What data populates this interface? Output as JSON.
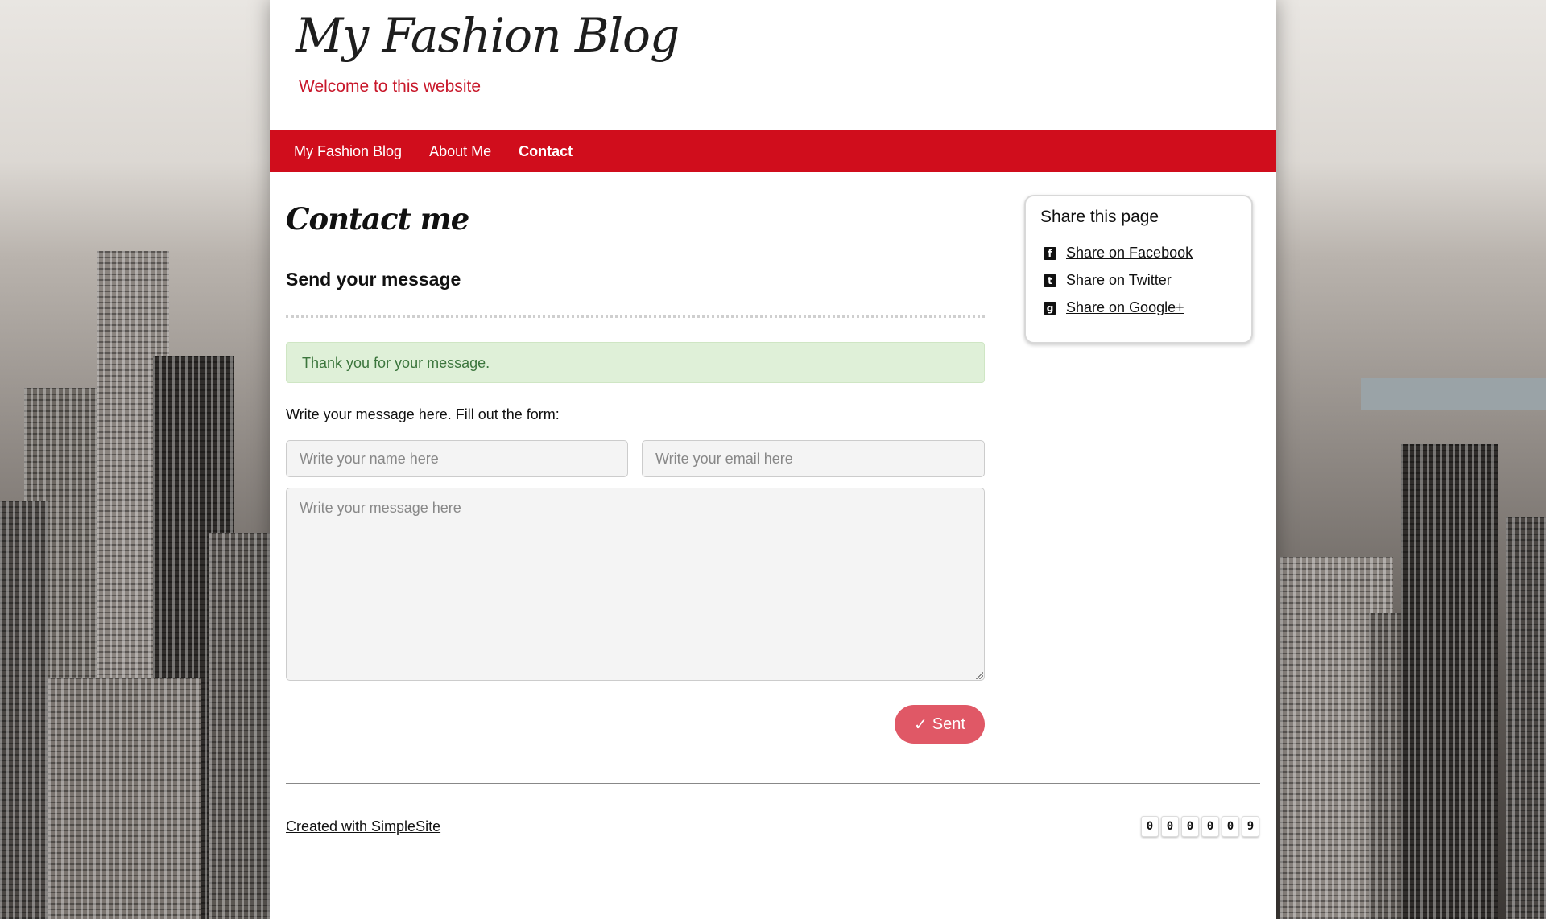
{
  "header": {
    "site_title": "My Fashion Blog",
    "tagline": "Welcome to this website"
  },
  "nav": {
    "items": [
      {
        "label": "My Fashion Blog"
      },
      {
        "label": "About Me"
      },
      {
        "label": "Contact",
        "active": true
      }
    ]
  },
  "main": {
    "page_title": "Contact me",
    "section_title": "Send your message",
    "alert": "Thank you for your message.",
    "instructions": "Write your message here. Fill out the form:",
    "form": {
      "name_placeholder": "Write your name here",
      "email_placeholder": "Write your email here",
      "message_placeholder": "Write your message here",
      "submit_label": "Sent",
      "submit_icon": "✓"
    }
  },
  "sidebar": {
    "title": "Share this page",
    "items": [
      {
        "label": "Share on Facebook",
        "icon": "facebook-icon",
        "glyph": "f"
      },
      {
        "label": "Share on Twitter",
        "icon": "twitter-icon",
        "glyph": "t"
      },
      {
        "label": "Share on Google+",
        "icon": "google-plus-icon",
        "glyph": "g"
      }
    ]
  },
  "footer": {
    "credit": "Created with SimpleSite",
    "counter_digits": [
      "0",
      "0",
      "0",
      "0",
      "0",
      "9"
    ]
  },
  "colors": {
    "nav_background": "#d00d1c",
    "tagline": "#c8172a",
    "alert_background": "#dff0d8",
    "alert_text": "#3c763d",
    "submit_button": "#e05866"
  }
}
